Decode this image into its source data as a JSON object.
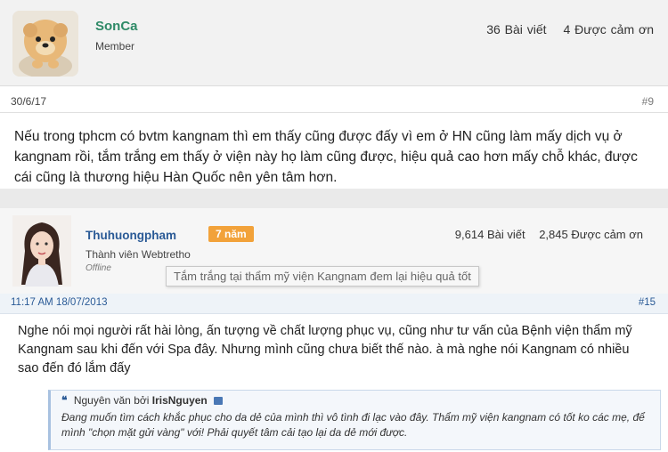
{
  "post1": {
    "username": "SonCa",
    "role": "Member",
    "stats": {
      "posts": "36 Bài viết",
      "thanks": "4 Được cảm ơn"
    },
    "date": "30/6/17",
    "post_number": "#9",
    "content": "Nếu trong tphcm có bvtm kangnam thì em thấy cũng được đấy vì em ở HN cũng làm mấy dịch vụ ở kangnam rồi, tắm trắng em thấy ở viện này họ làm cũng được, hiệu quả cao hơn mấy chỗ khác, được cái cũng là thương hiệu Hàn Quốc nên yên tâm hơn."
  },
  "post2": {
    "username": "Thuhuongpham",
    "badge": "7 năm",
    "role": "Thành viên Webtretho",
    "status": "Offline",
    "tooltip": "Tắm trắng tại thẩm mỹ viện Kangnam đem lại hiệu quả tốt",
    "stats": {
      "posts": "9,614 Bài viết",
      "thanks": "2,845 Được cảm ơn"
    },
    "date": "11:17 AM 18/07/2013",
    "post_number": "#15",
    "content": "Nghe nói mọi người rất hài lòng, ấn tượng về chất lượng phục vụ, cũng như tư vấn của Bệnh viện thẩm mỹ Kangnam sau khi đến với Spa đây. Nhưng mình cũng chưa biết thế nào. à mà nghe nói Kangnam có nhiều sao đến đó lắm đấy",
    "quote": {
      "prefix": "Nguyên văn bởi",
      "author": "IrisNguyen",
      "text": "Đang muốn tìm cách khắc phục cho da dẻ của mình thì vô tình đi lạc vào đây. Thẩm mỹ viện kangnam có tốt ko các mẹ, để mình \"chọn mặt gửi vàng\" với! Phải quyết tâm cải tạo lại da dẻ mới được."
    }
  },
  "colors": {
    "username1": "#2f8a67",
    "username2": "#2a5a96",
    "badge": "#f2a23a",
    "quote_border": "#c9d8ea"
  }
}
